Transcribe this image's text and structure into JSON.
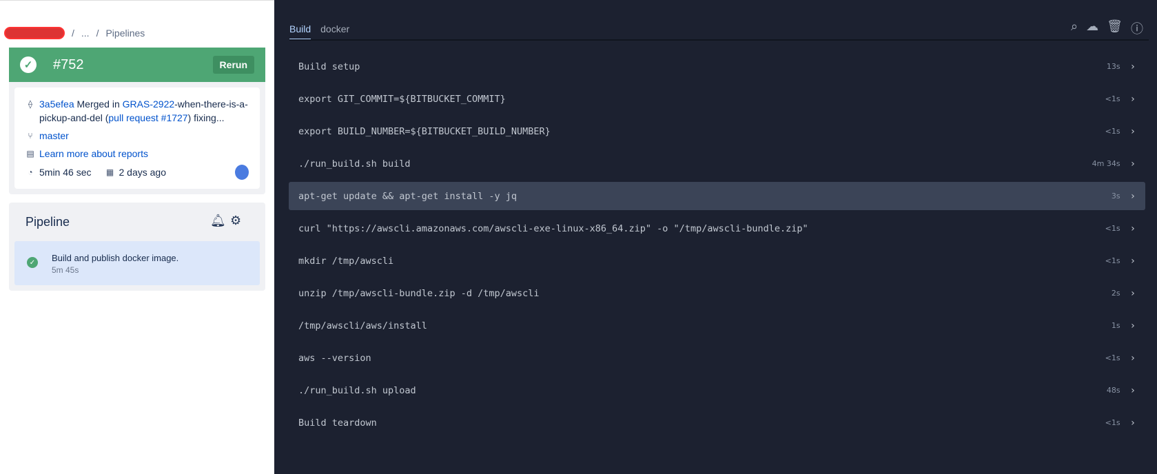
{
  "breadcrumb": {
    "ellipsis": "...",
    "current": "Pipelines"
  },
  "build": {
    "number": "#752",
    "rerun": "Rerun",
    "commit": "3a5efea",
    "merged_in": "Merged in",
    "branch_link": "GRAS-2922",
    "branch_rest": "-when-there-is-a-pickup-and-del (",
    "pr_link": "pull request #1727",
    "after_pr": ") fixing...",
    "branch": "master",
    "reports_link": "Learn more about reports",
    "duration": "5min 46 sec",
    "date": "2 days ago"
  },
  "pipeline": {
    "title": "Pipeline",
    "step_name": "Build and publish docker image.",
    "step_time": "5m 45s"
  },
  "log": {
    "tabs": [
      "Build",
      "docker"
    ],
    "rows": [
      {
        "cmd": "Build setup",
        "dur": "13s"
      },
      {
        "cmd": "export GIT_COMMIT=${BITBUCKET_COMMIT}",
        "dur": "<1s"
      },
      {
        "cmd": "export BUILD_NUMBER=${BITBUCKET_BUILD_NUMBER}",
        "dur": "<1s"
      },
      {
        "cmd": "./run_build.sh build",
        "dur": "4m 34s"
      },
      {
        "cmd": "apt-get update && apt-get install -y jq",
        "dur": "3s"
      },
      {
        "cmd": "curl \"https://awscli.amazonaws.com/awscli-exe-linux-x86_64.zip\" -o \"/tmp/awscli-bundle.zip\"",
        "dur": "<1s"
      },
      {
        "cmd": "mkdir /tmp/awscli",
        "dur": "<1s"
      },
      {
        "cmd": "unzip /tmp/awscli-bundle.zip -d /tmp/awscli",
        "dur": "2s"
      },
      {
        "cmd": "/tmp/awscli/aws/install",
        "dur": "1s"
      },
      {
        "cmd": "aws --version",
        "dur": "<1s"
      },
      {
        "cmd": "./run_build.sh upload",
        "dur": "48s"
      },
      {
        "cmd": "Build teardown",
        "dur": "<1s"
      }
    ]
  }
}
